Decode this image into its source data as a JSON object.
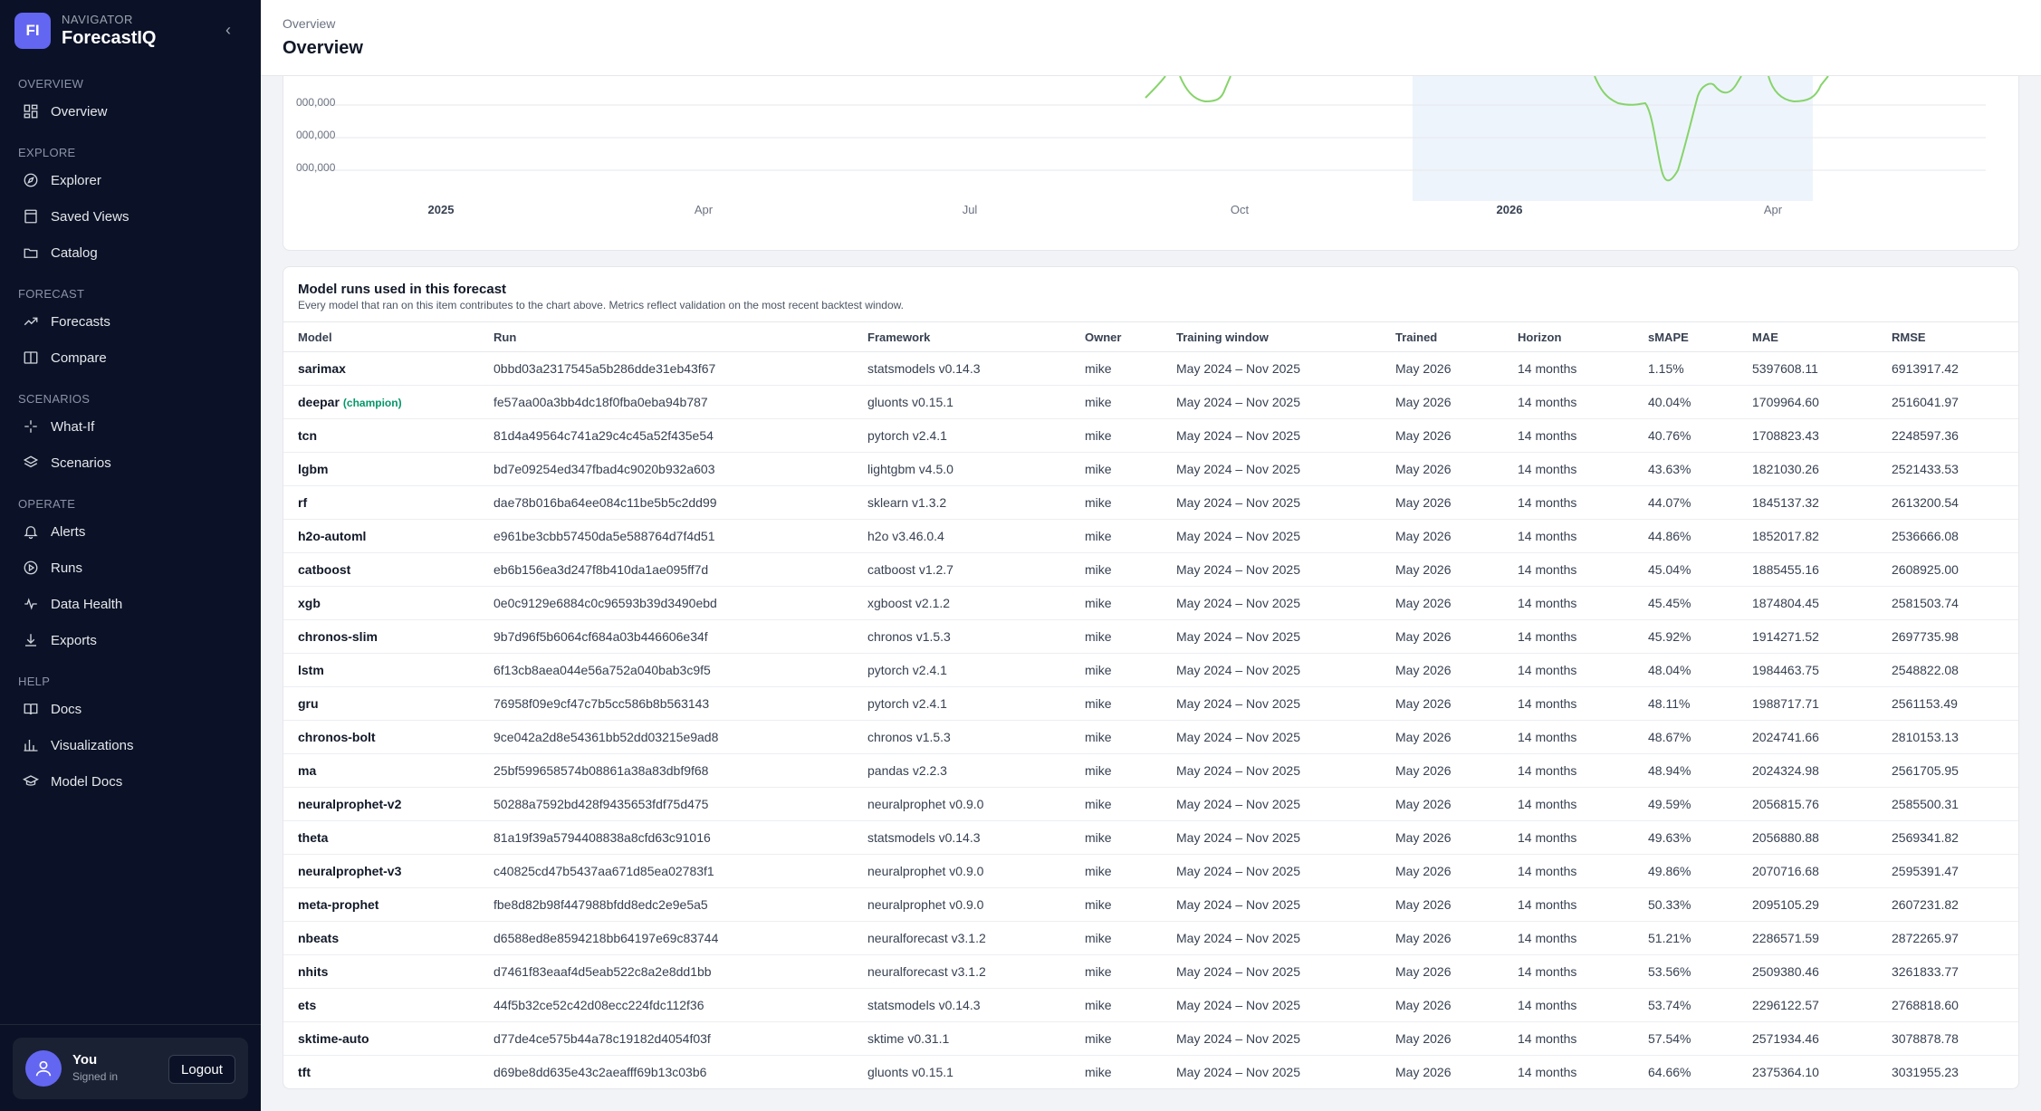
{
  "brand": {
    "badge": "FI",
    "subtitle": "NAVIGATOR",
    "name": "ForecastIQ"
  },
  "sidebar": {
    "collapse_icon": "chevron-left-icon",
    "sections": [
      {
        "title": "OVERVIEW",
        "items": [
          {
            "label": "Overview",
            "icon": "dashboard-icon"
          }
        ]
      },
      {
        "title": "EXPLORE",
        "items": [
          {
            "label": "Explorer",
            "icon": "compass-icon"
          },
          {
            "label": "Saved Views",
            "icon": "bookmark-icon"
          },
          {
            "label": "Catalog",
            "icon": "folder-icon"
          }
        ]
      },
      {
        "title": "FORECAST",
        "items": [
          {
            "label": "Forecasts",
            "icon": "trend-icon"
          },
          {
            "label": "Compare",
            "icon": "compare-icon"
          }
        ]
      },
      {
        "title": "SCENARIOS",
        "items": [
          {
            "label": "What-If",
            "icon": "sparkle-icon"
          },
          {
            "label": "Scenarios",
            "icon": "layers-icon"
          }
        ]
      },
      {
        "title": "OPERATE",
        "items": [
          {
            "label": "Alerts",
            "icon": "bell-icon"
          },
          {
            "label": "Runs",
            "icon": "play-circle-icon"
          },
          {
            "label": "Data Health",
            "icon": "pulse-icon"
          },
          {
            "label": "Exports",
            "icon": "download-icon"
          }
        ]
      },
      {
        "title": "HELP",
        "items": [
          {
            "label": "Docs",
            "icon": "book-icon"
          },
          {
            "label": "Visualizations",
            "icon": "bar-chart-icon"
          },
          {
            "label": "Model Docs",
            "icon": "graduation-cap-icon"
          }
        ]
      }
    ]
  },
  "user": {
    "name": "You",
    "status": "Signed in",
    "logout_label": "Logout"
  },
  "header": {
    "breadcrumb": "Overview",
    "title": "Overview"
  },
  "chart_data": {
    "type": "line",
    "y_tick_labels": [
      "000,000",
      "000,000",
      "000,000"
    ],
    "x_tick_labels": [
      "2025",
      "Apr",
      "Jul",
      "Oct",
      "2026",
      "Apr"
    ],
    "bold_x_ticks": [
      "2025",
      "2026"
    ],
    "forecast_shading": "from ~Jan 2026 to end of axis",
    "series_color": "#86d46a",
    "shading_color": "#eef4fc",
    "grid": true
  },
  "table": {
    "title": "Model runs used in this forecast",
    "subtitle": "Every model that ran on this item contributes to the chart above. Metrics reflect validation on the most recent backtest window.",
    "columns": [
      "Model",
      "Run",
      "Framework",
      "Owner",
      "Training window",
      "Trained",
      "Horizon",
      "sMAPE",
      "MAE",
      "RMSE"
    ],
    "rows": [
      {
        "model": "sarimax",
        "badge": "",
        "run": "0bbd03a2317545a5b286dde31eb43f67",
        "framework": "statsmodels v0.14.3",
        "owner": "mike",
        "window": "May 2024 – Nov 2025",
        "trained": "May 2026",
        "horizon": "14 months",
        "smape": "1.15%",
        "mae": "5397608.11",
        "rmse": "6913917.42"
      },
      {
        "model": "deepar",
        "badge": "(champion)",
        "run": "fe57aa00a3bb4dc18f0fba0eba94b787",
        "framework": "gluonts v0.15.1",
        "owner": "mike",
        "window": "May 2024 – Nov 2025",
        "trained": "May 2026",
        "horizon": "14 months",
        "smape": "40.04%",
        "mae": "1709964.60",
        "rmse": "2516041.97"
      },
      {
        "model": "tcn",
        "badge": "",
        "run": "81d4a49564c741a29c4c45a52f435e54",
        "framework": "pytorch v2.4.1",
        "owner": "mike",
        "window": "May 2024 – Nov 2025",
        "trained": "May 2026",
        "horizon": "14 months",
        "smape": "40.76%",
        "mae": "1708823.43",
        "rmse": "2248597.36"
      },
      {
        "model": "lgbm",
        "badge": "",
        "run": "bd7e09254ed347fbad4c9020b932a603",
        "framework": "lightgbm v4.5.0",
        "owner": "mike",
        "window": "May 2024 – Nov 2025",
        "trained": "May 2026",
        "horizon": "14 months",
        "smape": "43.63%",
        "mae": "1821030.26",
        "rmse": "2521433.53"
      },
      {
        "model": "rf",
        "badge": "",
        "run": "dae78b016ba64ee084c11be5b5c2dd99",
        "framework": "sklearn v1.3.2",
        "owner": "mike",
        "window": "May 2024 – Nov 2025",
        "trained": "May 2026",
        "horizon": "14 months",
        "smape": "44.07%",
        "mae": "1845137.32",
        "rmse": "2613200.54"
      },
      {
        "model": "h2o-automl",
        "badge": "",
        "run": "e961be3cbb57450da5e588764d7f4d51",
        "framework": "h2o v3.46.0.4",
        "owner": "mike",
        "window": "May 2024 – Nov 2025",
        "trained": "May 2026",
        "horizon": "14 months",
        "smape": "44.86%",
        "mae": "1852017.82",
        "rmse": "2536666.08"
      },
      {
        "model": "catboost",
        "badge": "",
        "run": "eb6b156ea3d247f8b410da1ae095ff7d",
        "framework": "catboost v1.2.7",
        "owner": "mike",
        "window": "May 2024 – Nov 2025",
        "trained": "May 2026",
        "horizon": "14 months",
        "smape": "45.04%",
        "mae": "1885455.16",
        "rmse": "2608925.00"
      },
      {
        "model": "xgb",
        "badge": "",
        "run": "0e0c9129e6884c0c96593b39d3490ebd",
        "framework": "xgboost v2.1.2",
        "owner": "mike",
        "window": "May 2024 – Nov 2025",
        "trained": "May 2026",
        "horizon": "14 months",
        "smape": "45.45%",
        "mae": "1874804.45",
        "rmse": "2581503.74"
      },
      {
        "model": "chronos-slim",
        "badge": "",
        "run": "9b7d96f5b6064cf684a03b446606e34f",
        "framework": "chronos v1.5.3",
        "owner": "mike",
        "window": "May 2024 – Nov 2025",
        "trained": "May 2026",
        "horizon": "14 months",
        "smape": "45.92%",
        "mae": "1914271.52",
        "rmse": "2697735.98"
      },
      {
        "model": "lstm",
        "badge": "",
        "run": "6f13cb8aea044e56a752a040bab3c9f5",
        "framework": "pytorch v2.4.1",
        "owner": "mike",
        "window": "May 2024 – Nov 2025",
        "trained": "May 2026",
        "horizon": "14 months",
        "smape": "48.04%",
        "mae": "1984463.75",
        "rmse": "2548822.08"
      },
      {
        "model": "gru",
        "badge": "",
        "run": "76958f09e9cf47c7b5cc586b8b563143",
        "framework": "pytorch v2.4.1",
        "owner": "mike",
        "window": "May 2024 – Nov 2025",
        "trained": "May 2026",
        "horizon": "14 months",
        "smape": "48.11%",
        "mae": "1988717.71",
        "rmse": "2561153.49"
      },
      {
        "model": "chronos-bolt",
        "badge": "",
        "run": "9ce042a2d8e54361bb52dd03215e9ad8",
        "framework": "chronos v1.5.3",
        "owner": "mike",
        "window": "May 2024 – Nov 2025",
        "trained": "May 2026",
        "horizon": "14 months",
        "smape": "48.67%",
        "mae": "2024741.66",
        "rmse": "2810153.13"
      },
      {
        "model": "ma",
        "badge": "",
        "run": "25bf599658574b08861a38a83dbf9f68",
        "framework": "pandas v2.2.3",
        "owner": "mike",
        "window": "May 2024 – Nov 2025",
        "trained": "May 2026",
        "horizon": "14 months",
        "smape": "48.94%",
        "mae": "2024324.98",
        "rmse": "2561705.95"
      },
      {
        "model": "neuralprophet-v2",
        "badge": "",
        "run": "50288a7592bd428f9435653fdf75d475",
        "framework": "neuralprophet v0.9.0",
        "owner": "mike",
        "window": "May 2024 – Nov 2025",
        "trained": "May 2026",
        "horizon": "14 months",
        "smape": "49.59%",
        "mae": "2056815.76",
        "rmse": "2585500.31"
      },
      {
        "model": "theta",
        "badge": "",
        "run": "81a19f39a5794408838a8cfd63c91016",
        "framework": "statsmodels v0.14.3",
        "owner": "mike",
        "window": "May 2024 – Nov 2025",
        "trained": "May 2026",
        "horizon": "14 months",
        "smape": "49.63%",
        "mae": "2056880.88",
        "rmse": "2569341.82"
      },
      {
        "model": "neuralprophet-v3",
        "badge": "",
        "run": "c40825cd47b5437aa671d85ea02783f1",
        "framework": "neuralprophet v0.9.0",
        "owner": "mike",
        "window": "May 2024 – Nov 2025",
        "trained": "May 2026",
        "horizon": "14 months",
        "smape": "49.86%",
        "mae": "2070716.68",
        "rmse": "2595391.47"
      },
      {
        "model": "meta-prophet",
        "badge": "",
        "run": "fbe8d82b98f447988bfdd8edc2e9e5a5",
        "framework": "neuralprophet v0.9.0",
        "owner": "mike",
        "window": "May 2024 – Nov 2025",
        "trained": "May 2026",
        "horizon": "14 months",
        "smape": "50.33%",
        "mae": "2095105.29",
        "rmse": "2607231.82"
      },
      {
        "model": "nbeats",
        "badge": "",
        "run": "d6588ed8e8594218bb64197e69c83744",
        "framework": "neuralforecast v3.1.2",
        "owner": "mike",
        "window": "May 2024 – Nov 2025",
        "trained": "May 2026",
        "horizon": "14 months",
        "smape": "51.21%",
        "mae": "2286571.59",
        "rmse": "2872265.97"
      },
      {
        "model": "nhits",
        "badge": "",
        "run": "d7461f83eaaf4d5eab522c8a2e8dd1bb",
        "framework": "neuralforecast v3.1.2",
        "owner": "mike",
        "window": "May 2024 – Nov 2025",
        "trained": "May 2026",
        "horizon": "14 months",
        "smape": "53.56%",
        "mae": "2509380.46",
        "rmse": "3261833.77"
      },
      {
        "model": "ets",
        "badge": "",
        "run": "44f5b32ce52c42d08ecc224fdc112f36",
        "framework": "statsmodels v0.14.3",
        "owner": "mike",
        "window": "May 2024 – Nov 2025",
        "trained": "May 2026",
        "horizon": "14 months",
        "smape": "53.74%",
        "mae": "2296122.57",
        "rmse": "2768818.60"
      },
      {
        "model": "sktime-auto",
        "badge": "",
        "run": "d77de4ce575b44a78c19182d4054f03f",
        "framework": "sktime v0.31.1",
        "owner": "mike",
        "window": "May 2024 – Nov 2025",
        "trained": "May 2026",
        "horizon": "14 months",
        "smape": "57.54%",
        "mae": "2571934.46",
        "rmse": "3078878.78"
      },
      {
        "model": "tft",
        "badge": "",
        "run": "d69be8dd635e43c2aeafff69b13c03b6",
        "framework": "gluonts v0.15.1",
        "owner": "mike",
        "window": "May 2024 – Nov 2025",
        "trained": "May 2026",
        "horizon": "14 months",
        "smape": "64.66%",
        "mae": "2375364.10",
        "rmse": "3031955.23"
      }
    ]
  }
}
